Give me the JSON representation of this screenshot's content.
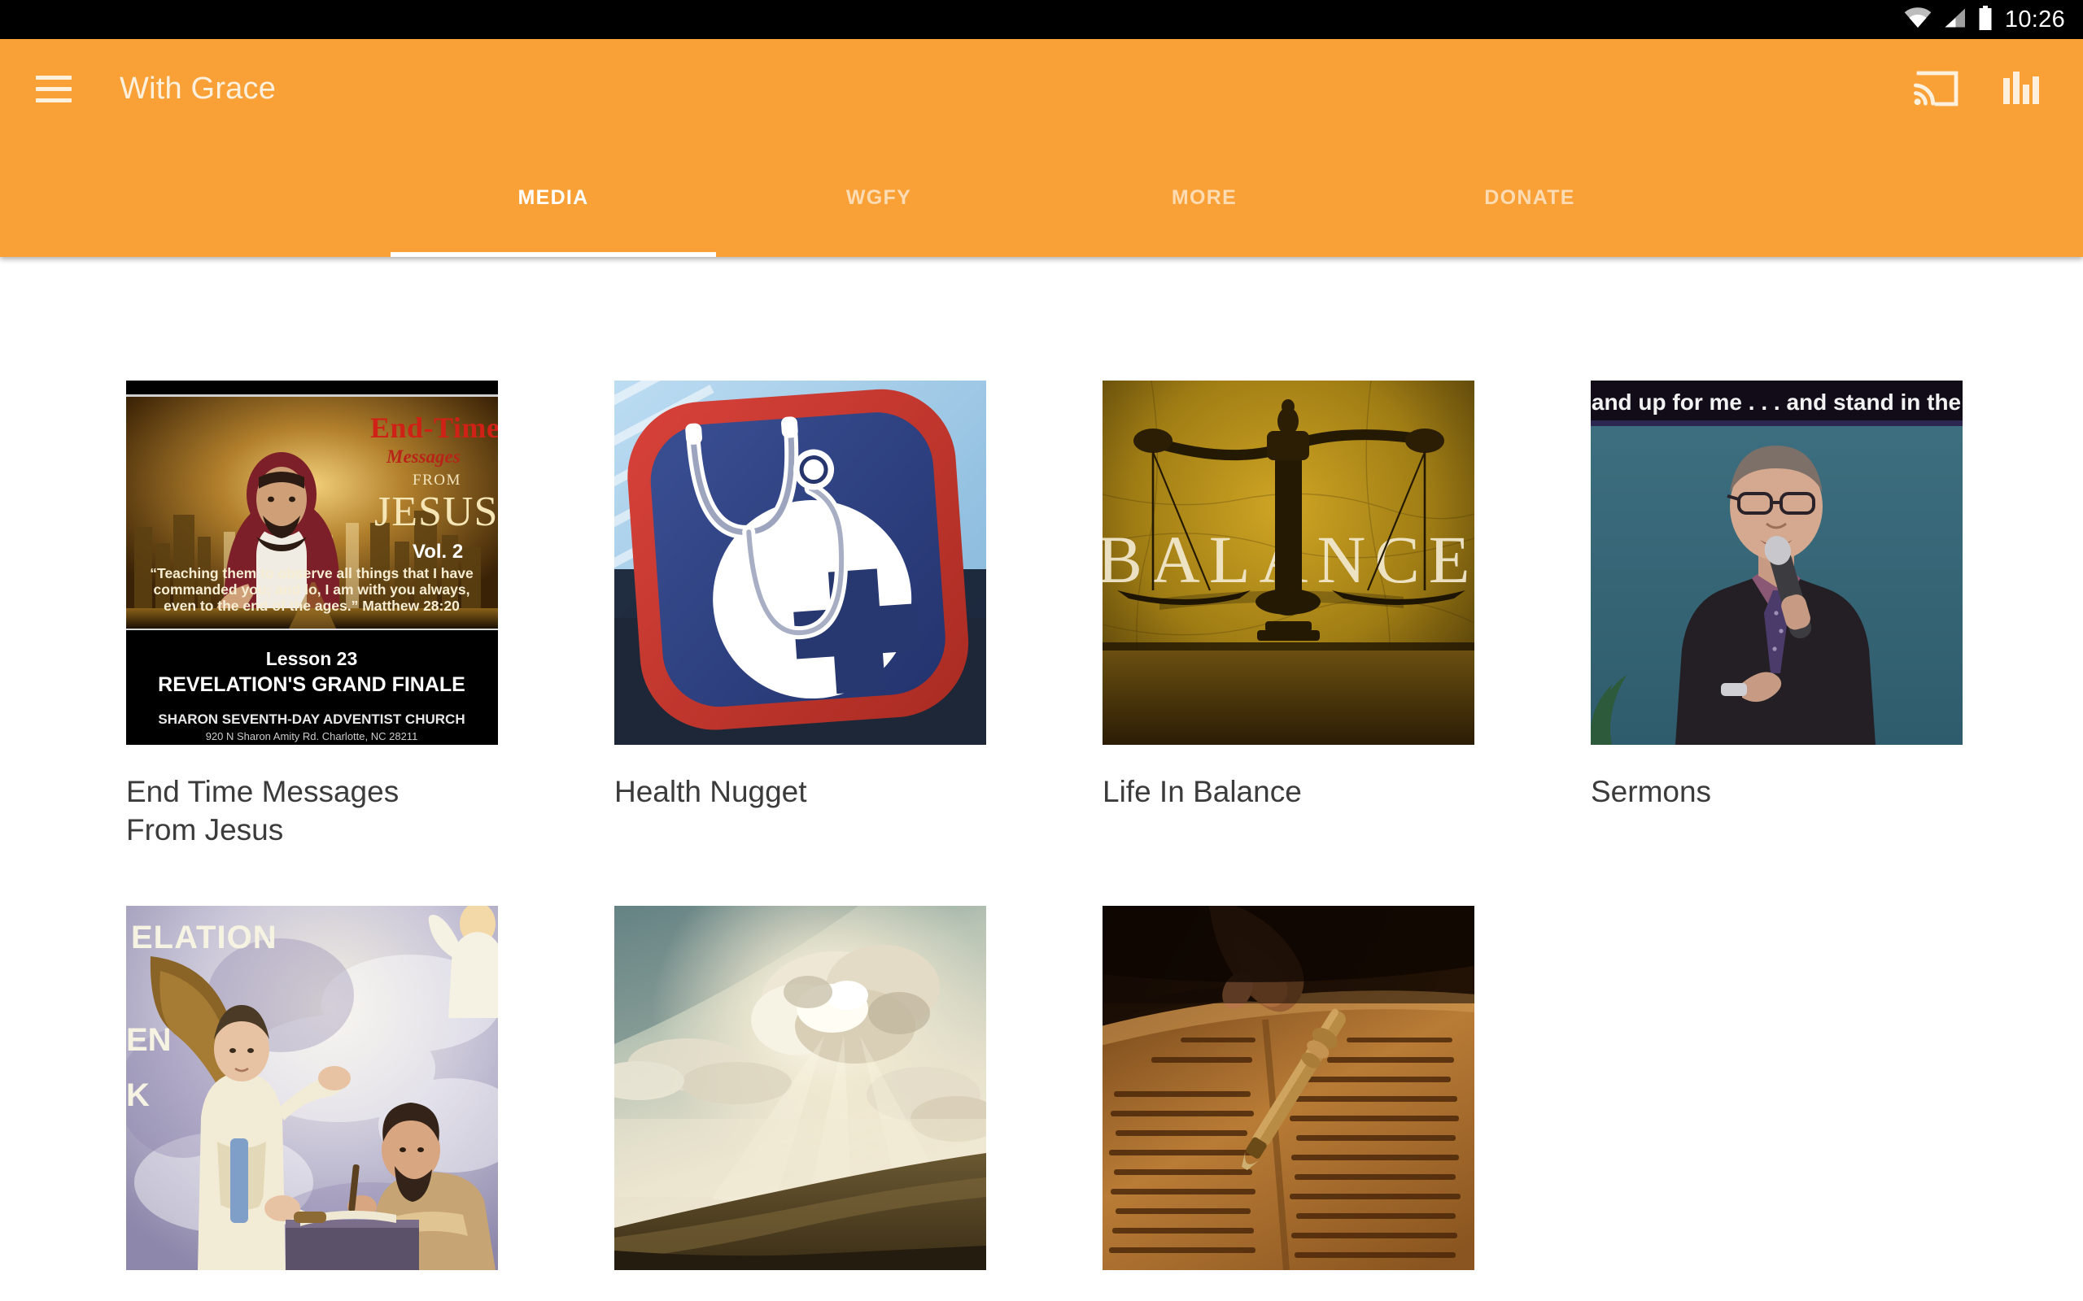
{
  "status_bar": {
    "time": "10:26",
    "icons": [
      "wifi-icon",
      "cellular-signal-icon",
      "battery-icon"
    ]
  },
  "app_bar": {
    "menu_icon": "hamburger-menu-icon",
    "title": "With Grace",
    "actions": [
      {
        "name": "cast-icon",
        "label": "Cast"
      },
      {
        "name": "equalizer-icon",
        "label": "Equalizer"
      }
    ]
  },
  "tabs": {
    "active_index": 0,
    "items": [
      {
        "label": "MEDIA"
      },
      {
        "label": "WGFY"
      },
      {
        "label": "MORE"
      },
      {
        "label": "DONATE"
      }
    ]
  },
  "media_grid": {
    "items": [
      {
        "title": "End Time Messages From Jesus",
        "thumbnail": "end-time-messages-dvd-cover",
        "thumb_text": {
          "headline": "End-Time",
          "sub1": "Messages",
          "sub2": "FROM",
          "sub3": "JESUS",
          "volume": "Vol. 2",
          "quote": "“Teaching them to observe all things that I have commanded you; and lo, I am with you always, even to the end of the ages.” Matthew 28:20",
          "lesson": "Lesson 23",
          "lesson_title": "REVELATION'S GRAND FINALE",
          "church": "SHARON SEVENTH-DAY ADVENTIST CHURCH",
          "address": "920 N Sharon Amity Rd. Charlotte, NC 28211"
        }
      },
      {
        "title": "Health Nugget",
        "thumbnail": "health-nugget-stethoscope-logo",
        "thumb_text": {}
      },
      {
        "title": "Life In Balance",
        "thumbnail": "balance-scales-photo",
        "thumb_text": {
          "word": "BALANCE"
        }
      },
      {
        "title": "Sermons",
        "thumbnail": "preacher-with-microphone-photo",
        "thumb_text": {
          "caption": "and up for me . . . and stand in the"
        }
      },
      {
        "title": "",
        "thumbnail": "revelation-angel-and-john-painting",
        "thumb_text": {
          "word": "ELATION",
          "word2": "EN",
          "word3": "K"
        }
      },
      {
        "title": "",
        "thumbnail": "sunlit-clouds-over-hills-photo",
        "thumb_text": {}
      },
      {
        "title": "",
        "thumbnail": "torah-scroll-with-yad-pointer-photo",
        "thumb_text": {}
      }
    ]
  },
  "colors": {
    "accent_orange": "#f9a037",
    "status_bar": "#000000",
    "title_text": "#fdf1de",
    "body_text": "#3b3b3b",
    "page_background": "#ffffff"
  }
}
